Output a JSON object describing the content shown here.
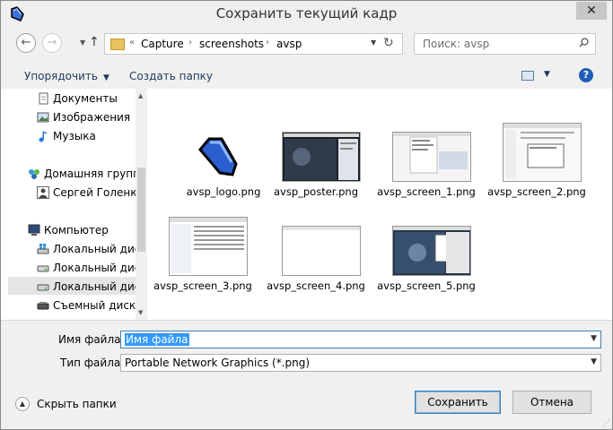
{
  "window": {
    "title": "Сохранить текущий кадр",
    "close_label": "✕"
  },
  "address": {
    "root_marker": "«",
    "crumbs": [
      "Capture",
      "screenshots",
      "avsp"
    ],
    "search_placeholder": "Поиск: avsp"
  },
  "toolbar": {
    "organize_label": "Упорядочить",
    "new_folder_label": "Создать папку"
  },
  "nav": {
    "items": [
      {
        "label": "Документы",
        "icon": "documents-icon"
      },
      {
        "label": "Изображения",
        "icon": "pictures-icon"
      },
      {
        "label": "Музыка",
        "icon": "music-icon"
      },
      {
        "label": "Домашняя группа",
        "icon": "homegroup-icon"
      },
      {
        "label": "Сергей Голенко",
        "icon": "user-icon"
      },
      {
        "label": "Компьютер",
        "icon": "computer-icon"
      },
      {
        "label": "Локальный диск",
        "icon": "windows-drive-icon"
      },
      {
        "label": "Локальный диск",
        "icon": "drive-icon"
      },
      {
        "label": "Локальный диск",
        "icon": "drive-icon"
      },
      {
        "label": "Съемный диск (",
        "icon": "removable-drive-icon"
      }
    ]
  },
  "files": [
    {
      "name": "avsp_logo.png",
      "thumb": "logo"
    },
    {
      "name": "avsp_poster.png",
      "thumb": "poster"
    },
    {
      "name": "avsp_screen_1.png",
      "thumb": "window"
    },
    {
      "name": "avsp_screen_2.png",
      "thumb": "window"
    },
    {
      "name": "avsp_screen_3.png",
      "thumb": "window"
    },
    {
      "name": "avsp_screen_4.png",
      "thumb": "blank"
    },
    {
      "name": "avsp_screen_5.png",
      "thumb": "video"
    }
  ],
  "form": {
    "filename_label": "Имя файла:",
    "filename_value": "Имя файла",
    "filetype_label": "Тип файла:",
    "filetype_value": "Portable Network Graphics (*.png)"
  },
  "footer": {
    "hide_folders_label": "Скрыть папки",
    "save_label": "Сохранить",
    "cancel_label": "Отмена"
  },
  "colors": {
    "accent": "#1f5fb5",
    "selection": "#3399ff",
    "folder": "#e8c25a"
  }
}
